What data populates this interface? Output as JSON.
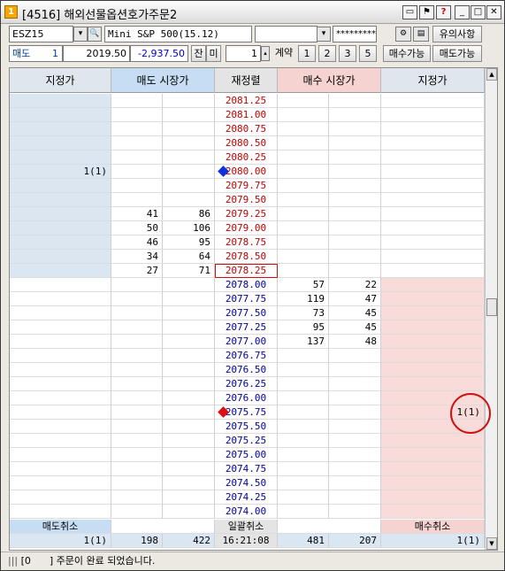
{
  "window": {
    "title": "[4516] 해외선물옵션호가주문2"
  },
  "toolbar": {
    "symbol": "ESZ15",
    "product_name": "Mini S&P 500(15.12)",
    "account_dropdown": "",
    "password": "*********",
    "notice_label": "유의사항",
    "side_label": "매도",
    "side_qty": "1",
    "avg_price": "2019.50",
    "pnl": "-2,937.50",
    "jan_label": "잔",
    "mi_label": "미",
    "qty": "1",
    "contract_label": "계약",
    "qty_presets": [
      "1",
      "2",
      "3",
      "5"
    ],
    "buy_avail_label": "매수가능",
    "sell_avail_label": "매도가능"
  },
  "headers": [
    "지정가",
    "매도 시장가",
    "재정렬",
    "매수 시장가",
    "지정가"
  ],
  "rows": [
    {
      "sell_limit": "",
      "sell_mkt_a": "",
      "sell_mkt_b": "",
      "price": "2081.25",
      "buy_mkt_a": "",
      "buy_mkt_b": "",
      "buy_limit": ""
    },
    {
      "sell_limit": "",
      "sell_mkt_a": "",
      "sell_mkt_b": "",
      "price": "2081.00",
      "buy_mkt_a": "",
      "buy_mkt_b": "",
      "buy_limit": ""
    },
    {
      "sell_limit": "",
      "sell_mkt_a": "",
      "sell_mkt_b": "",
      "price": "2080.75",
      "buy_mkt_a": "",
      "buy_mkt_b": "",
      "buy_limit": ""
    },
    {
      "sell_limit": "",
      "sell_mkt_a": "",
      "sell_mkt_b": "",
      "price": "2080.50",
      "buy_mkt_a": "",
      "buy_mkt_b": "",
      "buy_limit": ""
    },
    {
      "sell_limit": "",
      "sell_mkt_a": "",
      "sell_mkt_b": "",
      "price": "2080.25",
      "buy_mkt_a": "",
      "buy_mkt_b": "",
      "buy_limit": ""
    },
    {
      "sell_limit": "1(1)",
      "sell_mkt_a": "",
      "sell_mkt_b": "",
      "price": "2080.00",
      "buy_mkt_a": "",
      "buy_mkt_b": "",
      "buy_limit": ""
    },
    {
      "sell_limit": "",
      "sell_mkt_a": "",
      "sell_mkt_b": "",
      "price": "2079.75",
      "buy_mkt_a": "",
      "buy_mkt_b": "",
      "buy_limit": ""
    },
    {
      "sell_limit": "",
      "sell_mkt_a": "",
      "sell_mkt_b": "",
      "price": "2079.50",
      "buy_mkt_a": "",
      "buy_mkt_b": "",
      "buy_limit": ""
    },
    {
      "sell_limit": "",
      "sell_mkt_a": "41",
      "sell_mkt_b": "86",
      "price": "2079.25",
      "buy_mkt_a": "",
      "buy_mkt_b": "",
      "buy_limit": ""
    },
    {
      "sell_limit": "",
      "sell_mkt_a": "50",
      "sell_mkt_b": "106",
      "price": "2079.00",
      "buy_mkt_a": "",
      "buy_mkt_b": "",
      "buy_limit": ""
    },
    {
      "sell_limit": "",
      "sell_mkt_a": "46",
      "sell_mkt_b": "95",
      "price": "2078.75",
      "buy_mkt_a": "",
      "buy_mkt_b": "",
      "buy_limit": ""
    },
    {
      "sell_limit": "",
      "sell_mkt_a": "34",
      "sell_mkt_b": "64",
      "price": "2078.50",
      "buy_mkt_a": "",
      "buy_mkt_b": "",
      "buy_limit": ""
    },
    {
      "sell_limit": "",
      "sell_mkt_a": "27",
      "sell_mkt_b": "71",
      "price": "2078.25",
      "buy_mkt_a": "",
      "buy_mkt_b": "",
      "buy_limit": ""
    },
    {
      "sell_limit": "",
      "sell_mkt_a": "",
      "sell_mkt_b": "",
      "price": "2078.00",
      "buy_mkt_a": "57",
      "buy_mkt_b": "22",
      "buy_limit": ""
    },
    {
      "sell_limit": "",
      "sell_mkt_a": "",
      "sell_mkt_b": "",
      "price": "2077.75",
      "buy_mkt_a": "119",
      "buy_mkt_b": "47",
      "buy_limit": ""
    },
    {
      "sell_limit": "",
      "sell_mkt_a": "",
      "sell_mkt_b": "",
      "price": "2077.50",
      "buy_mkt_a": "73",
      "buy_mkt_b": "45",
      "buy_limit": ""
    },
    {
      "sell_limit": "",
      "sell_mkt_a": "",
      "sell_mkt_b": "",
      "price": "2077.25",
      "buy_mkt_a": "95",
      "buy_mkt_b": "45",
      "buy_limit": ""
    },
    {
      "sell_limit": "",
      "sell_mkt_a": "",
      "sell_mkt_b": "",
      "price": "2077.00",
      "buy_mkt_a": "137",
      "buy_mkt_b": "48",
      "buy_limit": ""
    },
    {
      "sell_limit": "",
      "sell_mkt_a": "",
      "sell_mkt_b": "",
      "price": "2076.75",
      "buy_mkt_a": "",
      "buy_mkt_b": "",
      "buy_limit": ""
    },
    {
      "sell_limit": "",
      "sell_mkt_a": "",
      "sell_mkt_b": "",
      "price": "2076.50",
      "buy_mkt_a": "",
      "buy_mkt_b": "",
      "buy_limit": ""
    },
    {
      "sell_limit": "",
      "sell_mkt_a": "",
      "sell_mkt_b": "",
      "price": "2076.25",
      "buy_mkt_a": "",
      "buy_mkt_b": "",
      "buy_limit": ""
    },
    {
      "sell_limit": "",
      "sell_mkt_a": "",
      "sell_mkt_b": "",
      "price": "2076.00",
      "buy_mkt_a": "",
      "buy_mkt_b": "",
      "buy_limit": ""
    },
    {
      "sell_limit": "",
      "sell_mkt_a": "",
      "sell_mkt_b": "",
      "price": "2075.75",
      "buy_mkt_a": "",
      "buy_mkt_b": "",
      "buy_limit": "1(1)"
    },
    {
      "sell_limit": "",
      "sell_mkt_a": "",
      "sell_mkt_b": "",
      "price": "2075.50",
      "buy_mkt_a": "",
      "buy_mkt_b": "",
      "buy_limit": ""
    },
    {
      "sell_limit": "",
      "sell_mkt_a": "",
      "sell_mkt_b": "",
      "price": "2075.25",
      "buy_mkt_a": "",
      "buy_mkt_b": "",
      "buy_limit": ""
    },
    {
      "sell_limit": "",
      "sell_mkt_a": "",
      "sell_mkt_b": "",
      "price": "2075.00",
      "buy_mkt_a": "",
      "buy_mkt_b": "",
      "buy_limit": ""
    },
    {
      "sell_limit": "",
      "sell_mkt_a": "",
      "sell_mkt_b": "",
      "price": "2074.75",
      "buy_mkt_a": "",
      "buy_mkt_b": "",
      "buy_limit": ""
    },
    {
      "sell_limit": "",
      "sell_mkt_a": "",
      "sell_mkt_b": "",
      "price": "2074.50",
      "buy_mkt_a": "",
      "buy_mkt_b": "",
      "buy_limit": ""
    },
    {
      "sell_limit": "",
      "sell_mkt_a": "",
      "sell_mkt_b": "",
      "price": "2074.25",
      "buy_mkt_a": "",
      "buy_mkt_b": "",
      "buy_limit": ""
    },
    {
      "sell_limit": "",
      "sell_mkt_a": "",
      "sell_mkt_b": "",
      "price": "2074.00",
      "buy_mkt_a": "",
      "buy_mkt_b": "",
      "buy_limit": ""
    }
  ],
  "sell_rows_count": 13,
  "highlight_price": "2078.25",
  "markers": {
    "sell_marker_price": "2080.00",
    "buy_marker_price": "2075.75"
  },
  "footer": {
    "sell_cancel": "매도취소",
    "bulk_cancel": "일괄취소",
    "buy_cancel": "매수취소",
    "sell_limit_total": "1(1)",
    "sell_mkt_total": "198",
    "sell_mkt_total_b": "422",
    "time": "16:21:08",
    "buy_mkt_total": "481",
    "buy_mkt_total_b": "207",
    "buy_limit_total": "1(1)"
  },
  "status": {
    "prefix": "|||",
    "message": "[0      ] 주문이 완료 되었습니다."
  },
  "colors": {
    "sell_blue": "#dbe6f3",
    "buy_pink": "#f9dcda",
    "sell_price_color": "#c00000",
    "buy_price_color": "#00009c",
    "sell_marker": "#1030e0",
    "buy_marker": "#e01010"
  }
}
